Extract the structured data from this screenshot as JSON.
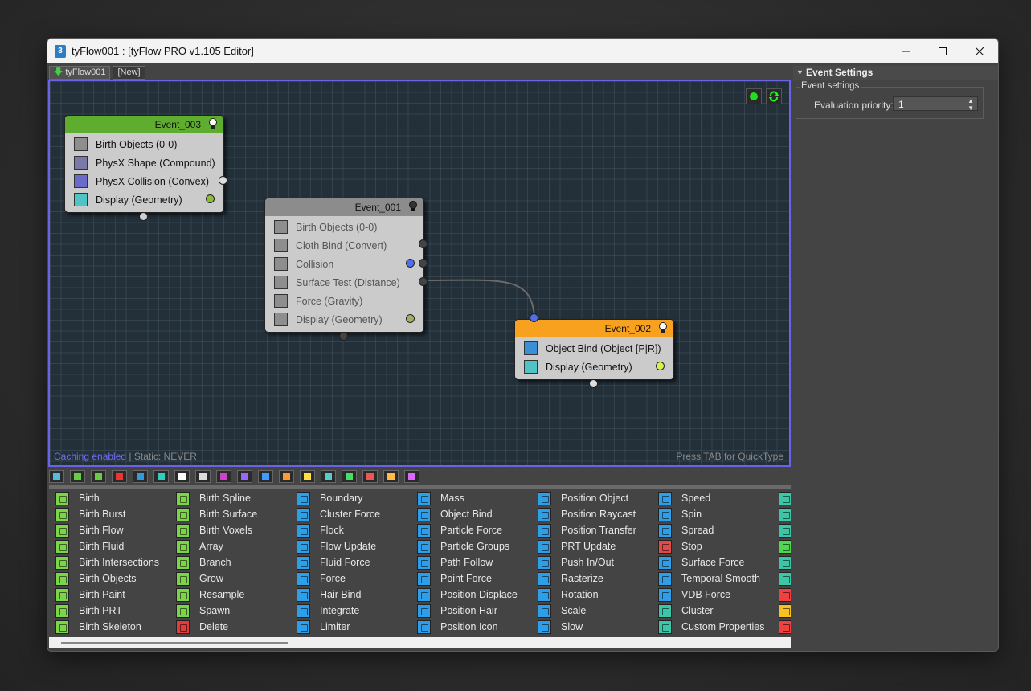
{
  "window": {
    "title": "tyFlow001 : [tyFlow PRO v1.105 Editor]",
    "app_icon_label": "3"
  },
  "tabs": [
    {
      "label": "tyFlow001"
    },
    {
      "label": "[New]"
    }
  ],
  "canvas": {
    "status_cache": "Caching enabled",
    "status_sep": "|",
    "status_static": "Static: NEVER",
    "quicktype_hint": "Press TAB for QuickType"
  },
  "events": {
    "e3": {
      "title": "Event_003",
      "header_color": "#5fad2f",
      "operators": [
        {
          "label": "Birth Objects (0-0)"
        },
        {
          "label": "PhysX Shape (Compound)"
        },
        {
          "label": "PhysX Collision (Convex)"
        },
        {
          "label": "Display (Geometry)"
        }
      ]
    },
    "e1": {
      "title": "Event_001",
      "header_color": "#8c8c8c",
      "operators": [
        {
          "label": "Birth Objects (0-0)"
        },
        {
          "label": "Cloth Bind (Convert)"
        },
        {
          "label": "Collision"
        },
        {
          "label": "Surface Test (Distance)"
        },
        {
          "label": "Force (Gravity)"
        },
        {
          "label": "Display (Geometry)"
        }
      ]
    },
    "e2": {
      "title": "Event_002",
      "header_color": "#f7a11f",
      "operators": [
        {
          "label": "Object Bind (Object [P|R])"
        },
        {
          "label": "Display (Geometry)"
        }
      ]
    }
  },
  "right_panel": {
    "section_title": "Event Settings",
    "group_title": "Event settings",
    "priority_label": "Evaluation priority:",
    "priority_value": "1"
  },
  "operator_library": {
    "columns": [
      {
        "color": "green",
        "items": [
          "Birth",
          "Birth Burst",
          "Birth Flow",
          "Birth Fluid",
          "Birth Intersections",
          "Birth Objects",
          "Birth Paint",
          "Birth PRT",
          "Birth Skeleton"
        ]
      },
      {
        "color": "green",
        "items": [
          "Birth Spline",
          "Birth Surface",
          "Birth Voxels",
          "Array",
          "Branch",
          "Grow",
          "Resample",
          "Spawn",
          "Delete"
        ]
      },
      {
        "color": "blue",
        "items": [
          "Boundary",
          "Cluster Force",
          "Flock",
          "Flow Update",
          "Fluid Force",
          "Force",
          "Hair Bind",
          "Integrate",
          "Limiter"
        ]
      },
      {
        "color": "blue",
        "items": [
          "Mass",
          "Object Bind",
          "Particle Force",
          "Particle Groups",
          "Path Follow",
          "Point Force",
          "Position Displace",
          "Position Hair",
          "Position Icon"
        ]
      },
      {
        "color": "blue",
        "items": [
          "Position Object",
          "Position Raycast",
          "Position Transfer",
          "PRT Update",
          "Push In/Out",
          "Rasterize",
          "Rotation",
          "Scale",
          "Slow"
        ]
      },
      {
        "color": "blue",
        "items": [
          "Speed",
          "Spin",
          "Spread",
          "Stop",
          "Surface Force",
          "Temporal Smooth",
          "VDB Force",
          "Cluster",
          "Custom Properties"
        ]
      }
    ]
  },
  "colors": {
    "accent": "#6b62e6",
    "port_blue": "#4f6ee8",
    "port_green": "#a8d44a"
  }
}
